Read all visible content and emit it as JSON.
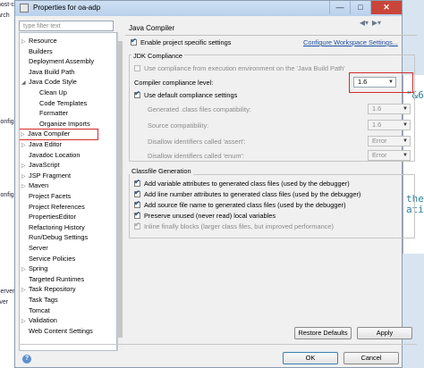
{
  "window": {
    "title": "Properties for oa-adp",
    "minimize": "—",
    "maximize": "□",
    "close": "✕"
  },
  "background": {
    "left_fragments": [
      "nost-c",
      "arch",
      "config",
      "config",
      "server",
      "rver"
    ],
    "right_fragments": [
      "\"&6",
      "the",
      "atic"
    ]
  },
  "filter": {
    "placeholder": "type filter text"
  },
  "tree": [
    {
      "label": "Resource",
      "expandable": true
    },
    {
      "label": "Builders",
      "expandable": false
    },
    {
      "label": "Deployment Assembly",
      "expandable": false
    },
    {
      "label": "Java Build Path",
      "expandable": false
    },
    {
      "label": "Java Code Style",
      "expandable": true,
      "expanded": true
    },
    {
      "label": "Clean Up",
      "expandable": false,
      "child": true
    },
    {
      "label": "Code Templates",
      "expandable": false,
      "child": true
    },
    {
      "label": "Formatter",
      "expandable": false,
      "child": true
    },
    {
      "label": "Organize Imports",
      "expandable": false,
      "child": true
    },
    {
      "label": "Java Compiler",
      "expandable": true,
      "selected": true
    },
    {
      "label": "Java Editor",
      "expandable": true
    },
    {
      "label": "Javadoc Location",
      "expandable": false
    },
    {
      "label": "JavaScript",
      "expandable": true
    },
    {
      "label": "JSP Fragment",
      "expandable": true
    },
    {
      "label": "Maven",
      "expandable": true
    },
    {
      "label": "Project Facets",
      "expandable": false
    },
    {
      "label": "Project References",
      "expandable": false
    },
    {
      "label": "PropertiesEditor",
      "expandable": false
    },
    {
      "label": "Refactoring History",
      "expandable": false
    },
    {
      "label": "Run/Debug Settings",
      "expandable": false
    },
    {
      "label": "Server",
      "expandable": false
    },
    {
      "label": "Service Policies",
      "expandable": false
    },
    {
      "label": "Spring",
      "expandable": true
    },
    {
      "label": "Targeted Runtimes",
      "expandable": false
    },
    {
      "label": "Task Repository",
      "expandable": true
    },
    {
      "label": "Task Tags",
      "expandable": false
    },
    {
      "label": "Tomcat",
      "expandable": false
    },
    {
      "label": "Validation",
      "expandable": true
    },
    {
      "label": "Web Content Settings",
      "expandable": false
    }
  ],
  "page": {
    "title": "Java Compiler",
    "enable_project_specific": "Enable project specific settings",
    "configure_workspace_link": "Configure Workspace Settings...",
    "jdk_group_title": "JDK Compliance",
    "use_execution_env": "Use compliance from execution environment on the 'Java Build Path'",
    "compliance_level_label": "Compiler compliance level:",
    "compliance_level_value": "1.6",
    "use_default_settings": "Use default compliance settings",
    "generated_class_label": "Generated .class files compatibility:",
    "generated_class_value": "1.6",
    "source_compat_label": "Source compatibility:",
    "source_compat_value": "1.6",
    "disallow_assert_label": "Disallow identifiers called 'assert':",
    "disallow_assert_value": "Error",
    "disallow_enum_label": "Disallow identifiers called 'enum':",
    "disallow_enum_value": "Error",
    "classfile_group_title": "Classfile Generation",
    "classfile_options": [
      {
        "label": "Add variable attributes to generated class files (used by the debugger)",
        "checked": true,
        "enabled": true
      },
      {
        "label": "Add line number attributes to generated class files (used by the debugger)",
        "checked": true,
        "enabled": true
      },
      {
        "label": "Add source file name to generated class files (used by the debugger)",
        "checked": true,
        "enabled": true
      },
      {
        "label": "Preserve unused (never read) local variables",
        "checked": true,
        "enabled": true
      },
      {
        "label": "Inline finally blocks (larger class files, but improved performance)",
        "checked": true,
        "enabled": false
      }
    ],
    "restore_defaults": "Restore Defaults",
    "apply": "Apply"
  },
  "footer": {
    "ok": "OK",
    "cancel": "Cancel",
    "help_icon": "help-icon"
  },
  "colors": {
    "highlight_red": "#d42b2b",
    "link_blue": "#1f4fa0",
    "title_gradient": "#b9d1ec"
  }
}
